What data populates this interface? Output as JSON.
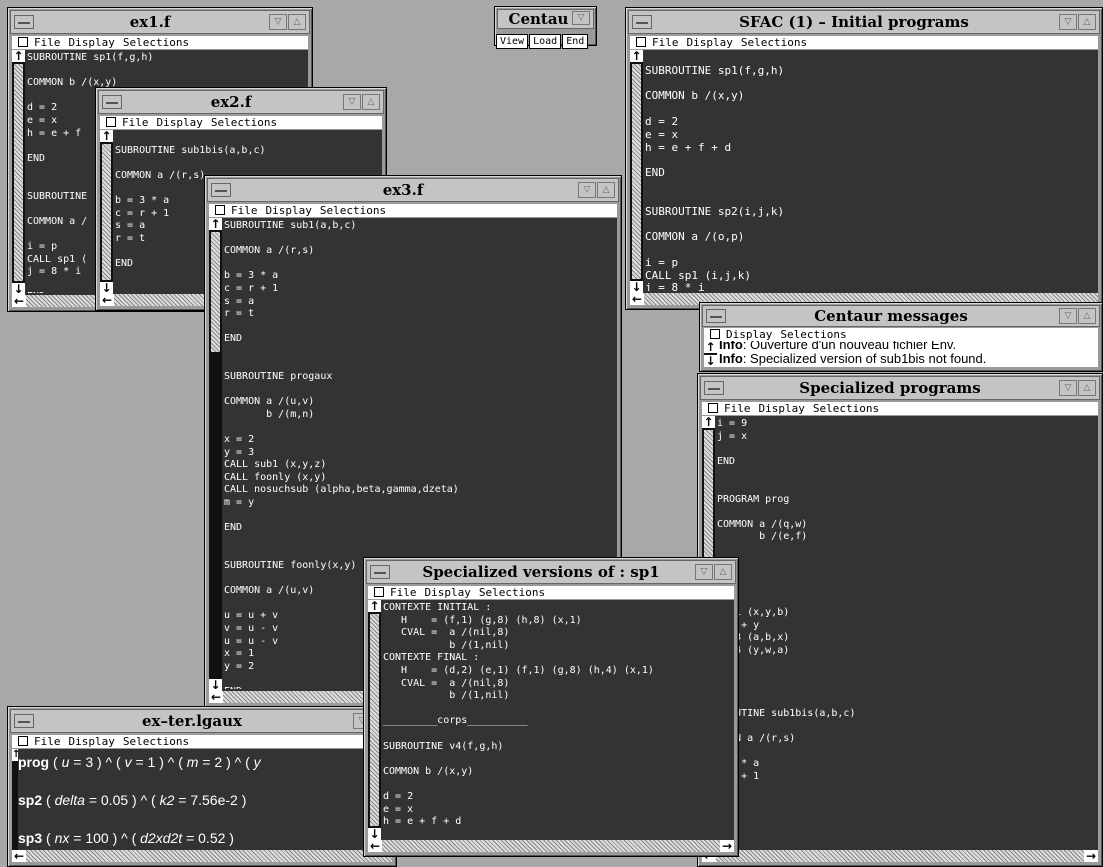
{
  "menu": {
    "file": "File",
    "display": "Display",
    "selections": "Selections"
  },
  "scroll": {
    "up": "↑",
    "down": "↓",
    "left": "←",
    "right": "→"
  },
  "centaur_panel": {
    "title": "Centau",
    "view": "View",
    "load": "Load",
    "end": "End"
  },
  "ex1": {
    "title": "ex1.f",
    "code": "SUBROUTINE sp1(f,g,h)\n\nCOMMON b /(x,y)\n\nd = 2\ne = x\nh = e + f\n\nEND\n\n\nSUBROUTINE\n\nCOMMON a /\n\ni = p\nCALL sp1 (\nj = 8 * i\n\nEND"
  },
  "ex2": {
    "title": "ex2.f",
    "code": "\nSUBROUTINE sub1bis(a,b,c)\n\nCOMMON a /(r,s)\n\nb = 3 * a\nc = r + 1\ns = a\nr = t\n\nEND"
  },
  "ex3": {
    "title": "ex3.f",
    "code": "SUBROUTINE sub1(a,b,c)\n\nCOMMON a /(r,s)\n\nb = 3 * a\nc = r + 1\ns = a\nr = t\n\nEND\n\n\nSUBROUTINE progaux\n\nCOMMON a /(u,v)\n       b /(m,n)\n\nx = 2\ny = 3\nCALL sub1 (x,y,z)\nCALL foonly (x,y)\nCALL nosuchsub (alpha,beta,gamma,dzeta)\nm = y\n\nEND\n\n\nSUBROUTINE foonly(x,y)\n\nCOMMON a /(u,v)\n\nu = u + v\nv = u - v\nu = u - v\nx = 1\ny = 2\n\nEND"
  },
  "sfac": {
    "title": "SFAC (1) – Initial programs",
    "code": "\nSUBROUTINE sp1(f,g,h)\n\nCOMMON b /(x,y)\n\nd = 2\ne = x\nh = e + f + d\n\nEND\n\n\nSUBROUTINE sp2(i,j,k)\n\nCOMMON a /(o,p)\n\ni = p\nCALL sp1 (i,j,k)\nj = 8 * i"
  },
  "messages": {
    "title": "Centaur messages",
    "display": "Display",
    "selections": "Selections",
    "info_label": "Info",
    "line1": ": Ouverture d'un nouveau fichier Env.",
    "line2": ": Specialized version of sub1bis not found."
  },
  "specialized": {
    "title": "Specialized programs",
    "code": "i = 9\nj = x\n\nEND\n\n\nPROGRAM prog\n\nCOMMON a /(q,w)\n       b /(e,f)\n\n  2\n  5\n  1\n  8\n. v1 (x,y,b)\n  8 + y\n. v3 (a,b,x)\n. v4 (y,w,a)\n\n\n\n\n ROUTINE sub1bis(a,b,c)\n\n  ON a /(r,s)\n\n  3 * a\n  r + 1\n  a\n  t"
  },
  "versions": {
    "title": "Specialized versions of : sp1",
    "code": "CONTEXTE INITIAL :\n   H    = (f,1) (g,8) (h,8) (x,1)\n   CVAL =  a /(nil,8)\n           b /(1,nil)\nCONTEXTE FINAL :\n   H    = (d,2) (e,1) (f,1) (g,8) (h,4) (x,1)\n   CVAL =  a /(nil,8)\n           b /(1,nil)\n\n_________corps__________\n\nSUBROUTINE v4(f,g,h)\n\nCOMMON b /(x,y)\n\nd = 2\ne = x\nh = e + f + d"
  },
  "exter": {
    "title": "ex–ter.lgaux",
    "l1": {
      "name": "prog",
      "a": " ( ",
      "v1": "u",
      "eq1": " = 3 ) ^ ( ",
      "v2": "v",
      "eq2": " = 1 ) ^ ( ",
      "v3": "m",
      "eq3": " = 2 ) ^ ( ",
      "v4": "y"
    },
    "l2": {
      "name": "sp2",
      "a": " ( ",
      "v1": "delta",
      "eq1": " = 0.05 ) ^ ( ",
      "v2": "k2",
      "eq2": " = 7.56e-2 )"
    },
    "l3": {
      "name": "sp3",
      "a": " ( ",
      "v1": "nx",
      "eq1": " = 100 ) ^ ( ",
      "v2": "d2xd2t",
      "eq2": " = 0.52 )"
    }
  },
  "icons": {
    "window_menu": "window-menu-icon",
    "minimize": "minimize-icon",
    "maximize": "maximize-icon"
  }
}
